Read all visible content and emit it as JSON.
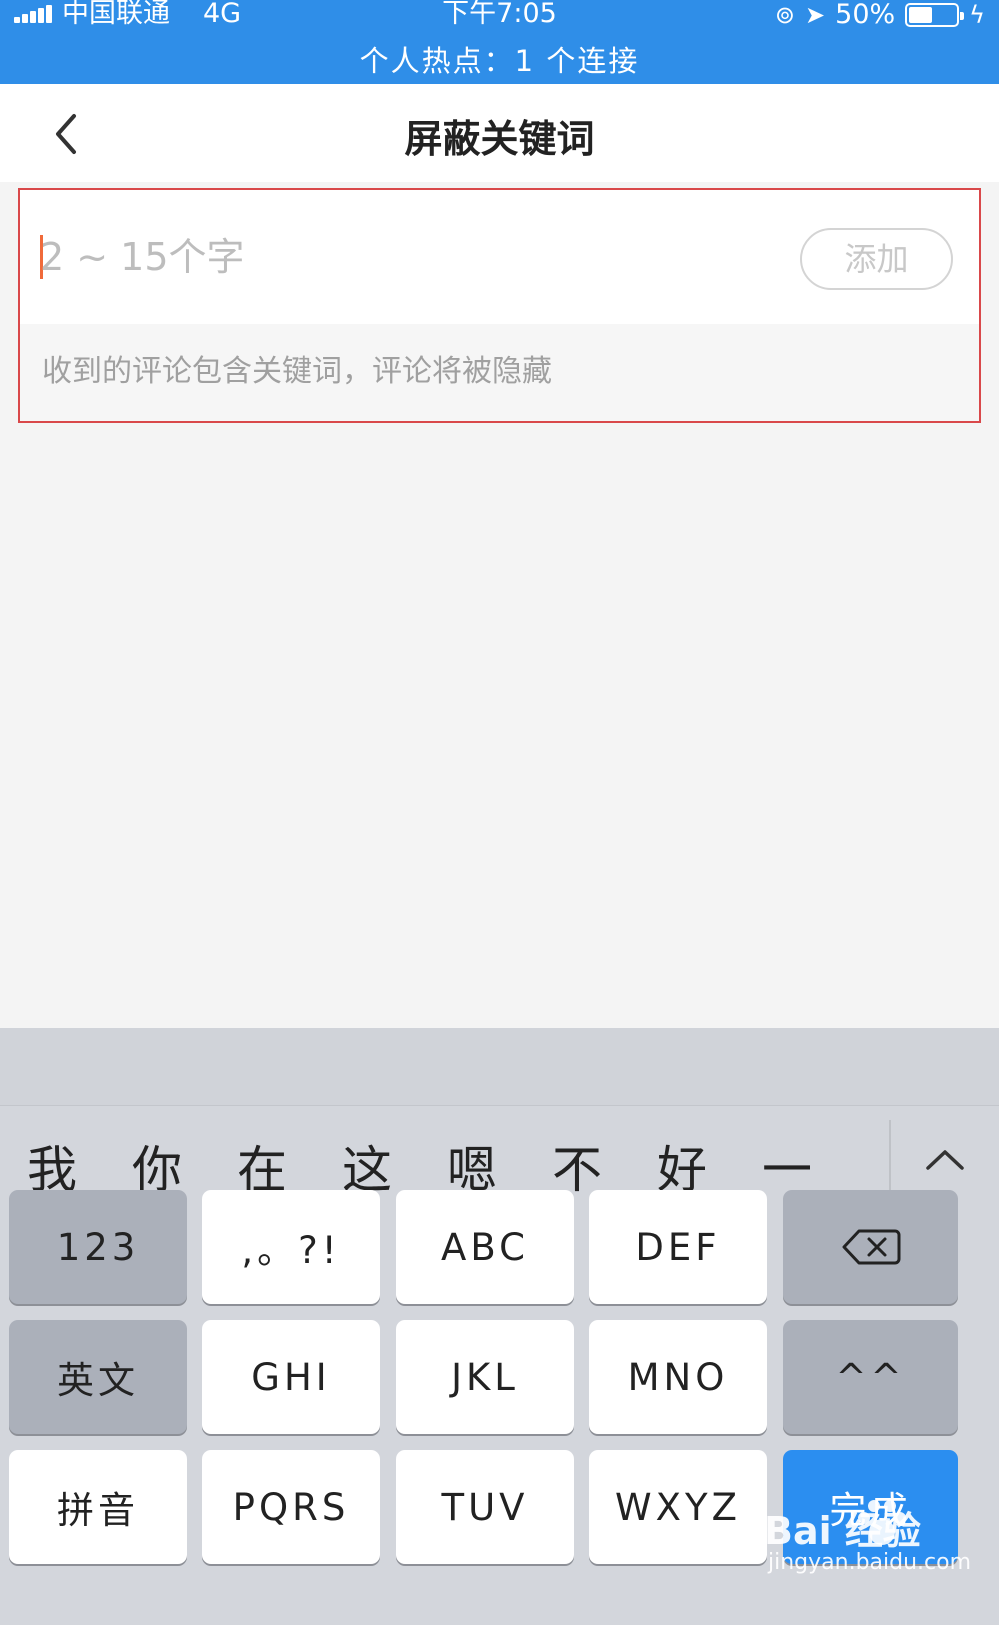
{
  "status_bar": {
    "carrier": "中国联通",
    "network": "4G",
    "time": "下午7:05",
    "battery_percent": "50%",
    "battery_level": 0.5,
    "hotspot": "个人热点：1 个连接"
  },
  "nav": {
    "title": "屏蔽关键词",
    "back_icon": "chevron-left-icon"
  },
  "keyword_form": {
    "placeholder": "2 ~ 15个字",
    "value": "",
    "add_label": "添加",
    "hint": "收到的评论包含关键词，评论将被隐藏"
  },
  "keyboard": {
    "candidates": [
      "我",
      "你",
      "在",
      "这",
      "嗯",
      "不",
      "好",
      "一"
    ],
    "expand_icon": "chevron-up-icon",
    "rows": [
      [
        {
          "label": "123",
          "style": "fn"
        },
        {
          "label": ",。?!",
          "style": "char"
        },
        {
          "label": "ABC",
          "style": "char"
        },
        {
          "label": "DEF",
          "style": "char"
        },
        {
          "label": "",
          "style": "fn",
          "icon": "backspace-icon"
        }
      ],
      [
        {
          "label": "英文",
          "style": "fn"
        },
        {
          "label": "GHI",
          "style": "char"
        },
        {
          "label": "JKL",
          "style": "char"
        },
        {
          "label": "MNO",
          "style": "char"
        },
        {
          "label": "^^",
          "style": "fn"
        }
      ],
      [
        {
          "label": "拼音",
          "style": "char"
        },
        {
          "label": "PQRS",
          "style": "char"
        },
        {
          "label": "TUV",
          "style": "char"
        },
        {
          "label": "WXYZ",
          "style": "char"
        },
        {
          "label": "完成",
          "style": "blue"
        }
      ]
    ]
  },
  "watermark": {
    "brand": "Bai  经验",
    "url": "jingyan.baidu.com"
  },
  "colors": {
    "status_bar": "#2f8ee8",
    "highlight_border": "#d9484a",
    "cursor": "#f06a3a",
    "done_key": "#2b8ef0"
  }
}
